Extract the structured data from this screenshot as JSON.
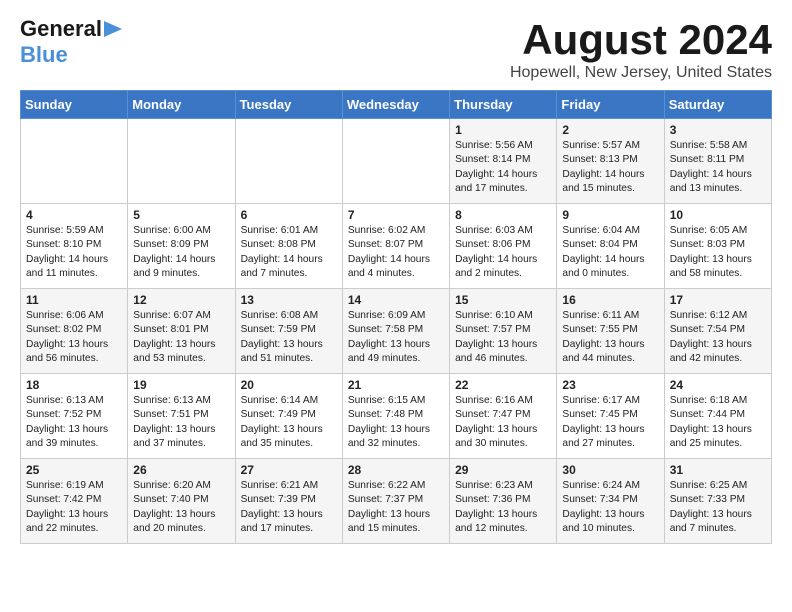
{
  "logo": {
    "general": "General",
    "blue": "Blue",
    "arrow": "►"
  },
  "title": "August 2024",
  "subtitle": "Hopewell, New Jersey, United States",
  "weekdays": [
    "Sunday",
    "Monday",
    "Tuesday",
    "Wednesday",
    "Thursday",
    "Friday",
    "Saturday"
  ],
  "weeks": [
    [
      {
        "day": "",
        "content": ""
      },
      {
        "day": "",
        "content": ""
      },
      {
        "day": "",
        "content": ""
      },
      {
        "day": "",
        "content": ""
      },
      {
        "day": "1",
        "content": "Sunrise: 5:56 AM\nSunset: 8:14 PM\nDaylight: 14 hours\nand 17 minutes."
      },
      {
        "day": "2",
        "content": "Sunrise: 5:57 AM\nSunset: 8:13 PM\nDaylight: 14 hours\nand 15 minutes."
      },
      {
        "day": "3",
        "content": "Sunrise: 5:58 AM\nSunset: 8:11 PM\nDaylight: 14 hours\nand 13 minutes."
      }
    ],
    [
      {
        "day": "4",
        "content": "Sunrise: 5:59 AM\nSunset: 8:10 PM\nDaylight: 14 hours\nand 11 minutes."
      },
      {
        "day": "5",
        "content": "Sunrise: 6:00 AM\nSunset: 8:09 PM\nDaylight: 14 hours\nand 9 minutes."
      },
      {
        "day": "6",
        "content": "Sunrise: 6:01 AM\nSunset: 8:08 PM\nDaylight: 14 hours\nand 7 minutes."
      },
      {
        "day": "7",
        "content": "Sunrise: 6:02 AM\nSunset: 8:07 PM\nDaylight: 14 hours\nand 4 minutes."
      },
      {
        "day": "8",
        "content": "Sunrise: 6:03 AM\nSunset: 8:06 PM\nDaylight: 14 hours\nand 2 minutes."
      },
      {
        "day": "9",
        "content": "Sunrise: 6:04 AM\nSunset: 8:04 PM\nDaylight: 14 hours\nand 0 minutes."
      },
      {
        "day": "10",
        "content": "Sunrise: 6:05 AM\nSunset: 8:03 PM\nDaylight: 13 hours\nand 58 minutes."
      }
    ],
    [
      {
        "day": "11",
        "content": "Sunrise: 6:06 AM\nSunset: 8:02 PM\nDaylight: 13 hours\nand 56 minutes."
      },
      {
        "day": "12",
        "content": "Sunrise: 6:07 AM\nSunset: 8:01 PM\nDaylight: 13 hours\nand 53 minutes."
      },
      {
        "day": "13",
        "content": "Sunrise: 6:08 AM\nSunset: 7:59 PM\nDaylight: 13 hours\nand 51 minutes."
      },
      {
        "day": "14",
        "content": "Sunrise: 6:09 AM\nSunset: 7:58 PM\nDaylight: 13 hours\nand 49 minutes."
      },
      {
        "day": "15",
        "content": "Sunrise: 6:10 AM\nSunset: 7:57 PM\nDaylight: 13 hours\nand 46 minutes."
      },
      {
        "day": "16",
        "content": "Sunrise: 6:11 AM\nSunset: 7:55 PM\nDaylight: 13 hours\nand 44 minutes."
      },
      {
        "day": "17",
        "content": "Sunrise: 6:12 AM\nSunset: 7:54 PM\nDaylight: 13 hours\nand 42 minutes."
      }
    ],
    [
      {
        "day": "18",
        "content": "Sunrise: 6:13 AM\nSunset: 7:52 PM\nDaylight: 13 hours\nand 39 minutes."
      },
      {
        "day": "19",
        "content": "Sunrise: 6:13 AM\nSunset: 7:51 PM\nDaylight: 13 hours\nand 37 minutes."
      },
      {
        "day": "20",
        "content": "Sunrise: 6:14 AM\nSunset: 7:49 PM\nDaylight: 13 hours\nand 35 minutes."
      },
      {
        "day": "21",
        "content": "Sunrise: 6:15 AM\nSunset: 7:48 PM\nDaylight: 13 hours\nand 32 minutes."
      },
      {
        "day": "22",
        "content": "Sunrise: 6:16 AM\nSunset: 7:47 PM\nDaylight: 13 hours\nand 30 minutes."
      },
      {
        "day": "23",
        "content": "Sunrise: 6:17 AM\nSunset: 7:45 PM\nDaylight: 13 hours\nand 27 minutes."
      },
      {
        "day": "24",
        "content": "Sunrise: 6:18 AM\nSunset: 7:44 PM\nDaylight: 13 hours\nand 25 minutes."
      }
    ],
    [
      {
        "day": "25",
        "content": "Sunrise: 6:19 AM\nSunset: 7:42 PM\nDaylight: 13 hours\nand 22 minutes."
      },
      {
        "day": "26",
        "content": "Sunrise: 6:20 AM\nSunset: 7:40 PM\nDaylight: 13 hours\nand 20 minutes."
      },
      {
        "day": "27",
        "content": "Sunrise: 6:21 AM\nSunset: 7:39 PM\nDaylight: 13 hours\nand 17 minutes."
      },
      {
        "day": "28",
        "content": "Sunrise: 6:22 AM\nSunset: 7:37 PM\nDaylight: 13 hours\nand 15 minutes."
      },
      {
        "day": "29",
        "content": "Sunrise: 6:23 AM\nSunset: 7:36 PM\nDaylight: 13 hours\nand 12 minutes."
      },
      {
        "day": "30",
        "content": "Sunrise: 6:24 AM\nSunset: 7:34 PM\nDaylight: 13 hours\nand 10 minutes."
      },
      {
        "day": "31",
        "content": "Sunrise: 6:25 AM\nSunset: 7:33 PM\nDaylight: 13 hours\nand 7 minutes."
      }
    ]
  ]
}
